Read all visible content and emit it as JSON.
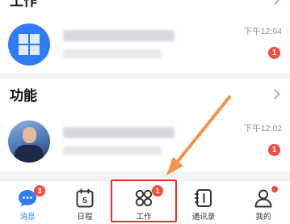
{
  "sections": [
    {
      "title": "工作"
    },
    {
      "title": "功能"
    }
  ],
  "rows": [
    {
      "time": "下午12:04",
      "badge": "1",
      "avatar_icon": "app-grid-icon"
    },
    {
      "time": "下午12:02",
      "badge": "1",
      "avatar_icon": "user-photo"
    }
  ],
  "tabbar": {
    "items": [
      {
        "label": "消息",
        "icon": "chat-bubble-icon",
        "badge": "3",
        "active": true
      },
      {
        "label": "日程",
        "icon": "calendar-icon",
        "calendar_day": "5"
      },
      {
        "label": "工作",
        "icon": "workbench-grid-icon",
        "badge": "1"
      },
      {
        "label": "通讯录",
        "icon": "contacts-book-icon"
      },
      {
        "label": "我的",
        "icon": "person-icon",
        "dot": true
      }
    ]
  },
  "annotation": {
    "highlight_color": "#e0312b",
    "arrow_color": "#f0954a"
  },
  "colors": {
    "accent": "#2f7cf6",
    "badge": "#f24e3d"
  }
}
